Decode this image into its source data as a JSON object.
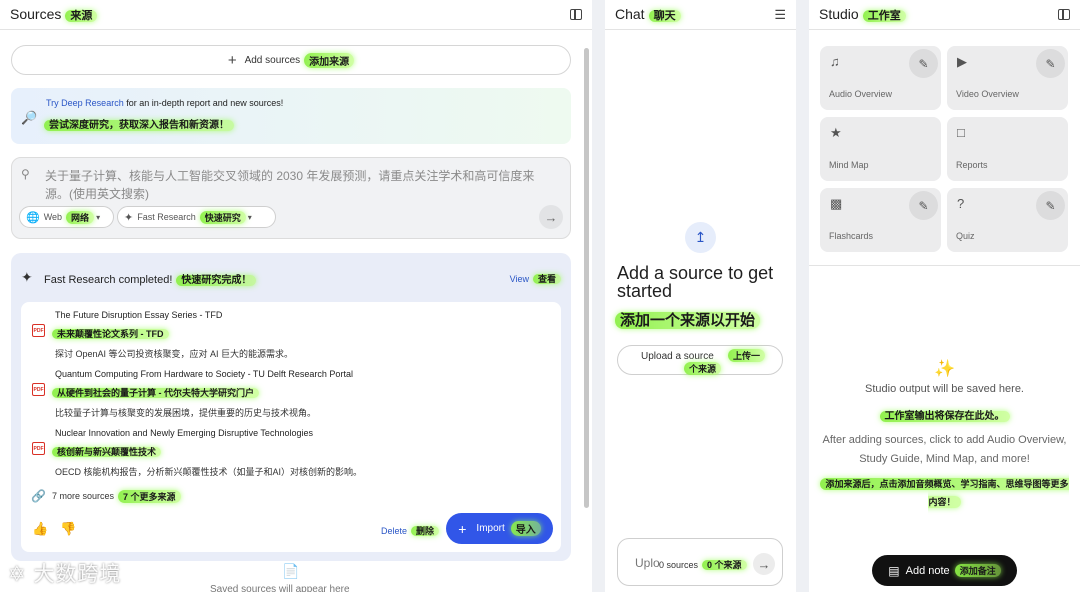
{
  "sources": {
    "title": "Sources",
    "title_cn": "来源",
    "add_sources": "Add sources",
    "add_sources_cn": "添加来源",
    "deep_link": "Try Deep Research",
    "deep_rest": " for an in-depth report and new sources!",
    "deep_cn": "尝试深度研究，获取深入报告和新资源！",
    "search_placeholder": "关于量子计算、核能与人工智能交叉领域的 2030 年发展预测，请重点关注学术和高可信度来源。(使用英文搜索)",
    "chip_web": "Web",
    "chip_web_cn": "网络",
    "chip_fast": "Fast Research",
    "chip_fast_cn": "快速研究",
    "fr_title": "Fast Research completed!",
    "fr_title_cn": "快速研究完成！",
    "view": "View",
    "view_cn": "查看",
    "items": [
      {
        "title": "The Future Disruption Essay Series - TFD",
        "cn": "未来颠覆性论文系列 - TFD",
        "desc": "探讨 OpenAI 等公司投资核聚变，应对 AI 巨大的能源需求。"
      },
      {
        "title": "Quantum Computing From Hardware to Society - TU Delft Research Portal",
        "cn": "从硬件到社会的量子计算 - 代尔夫特大学研究门户",
        "desc": "比较量子计算与核聚变的发展困境，提供重要的历史与技术视角。"
      },
      {
        "title": "Nuclear Innovation and Newly Emerging Disruptive Technologies",
        "cn": "核创新与新兴颠覆性技术",
        "desc": "OECD 核能机构报告，分析新兴颠覆性技术（如量子和AI）对核创新的影响。"
      }
    ],
    "more": "7 more sources",
    "more_cn": "7 个更多来源",
    "delete": "Delete",
    "delete_cn": "删除",
    "import": "Import",
    "import_cn": "导入",
    "saved_text": "Saved sources will appear here"
  },
  "watermark": "大数跨境",
  "chat": {
    "title": "Chat",
    "title_cn": "聊天",
    "heading": "Add a source to get started",
    "heading_cn": "添加一个来源以开始",
    "upload": "Upload a source",
    "upload_cn_1": "上传一",
    "upload_cn_2": "个来源",
    "input_prefix": "Uplo",
    "count": "0 sources",
    "count_cn": "0 个来源"
  },
  "studio": {
    "title": "Studio",
    "title_cn": "工作室",
    "tiles": [
      {
        "label": "Audio Overview"
      },
      {
        "label": "Video Overview"
      },
      {
        "label": "Mind Map"
      },
      {
        "label": "Reports"
      },
      {
        "label": "Flashcards"
      },
      {
        "label": "Quiz"
      }
    ],
    "output_text": "Studio output will be saved here.",
    "output_cn": "工作室输出将保存在此处。",
    "after_text": "After adding sources, click to add Audio Overview, Study Guide, Mind Map, and more!",
    "after_cn": "添加来源后，点击添加音频概览、学习指南、思维导图等更多内容！",
    "add_note": "Add note",
    "add_note_cn": "添加备注"
  }
}
